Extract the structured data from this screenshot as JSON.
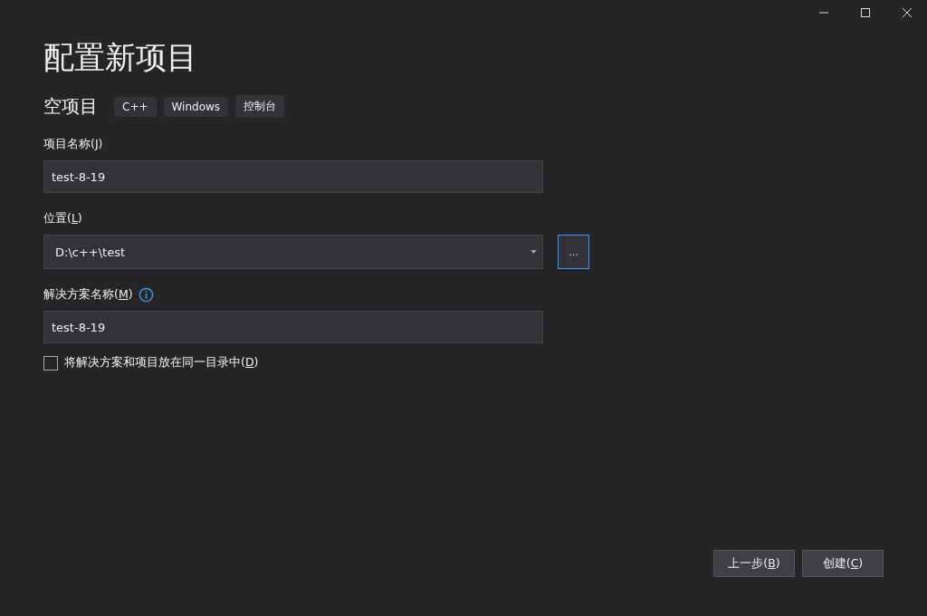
{
  "window": {
    "title": "配置新项目"
  },
  "template": {
    "name": "空项目",
    "tags": [
      "C++",
      "Windows",
      "控制台"
    ]
  },
  "fields": [
    {
      "kind": "text",
      "label": {
        "pre": "项目名称(",
        "key": "J",
        "post": ")"
      },
      "value": "test-8-19",
      "info": false
    },
    {
      "kind": "combo",
      "label": {
        "pre": "位置(",
        "key": "L",
        "post": ")"
      },
      "value": "D:\\c++\\test",
      "info": false,
      "browse": "...",
      "browse_focused": true
    },
    {
      "kind": "text",
      "label": {
        "pre": "解决方案名称(",
        "key": "M",
        "post": ")"
      },
      "value": "test-8-19",
      "info": true
    }
  ],
  "checkbox": {
    "label": {
      "pre": "将解决方案和项目放在同一目录中(",
      "key": "D",
      "post": ")"
    },
    "checked": false
  },
  "buttons": [
    {
      "pre": "上一步(",
      "key": "B",
      "post": ")"
    },
    {
      "pre": "创建(",
      "key": "C",
      "post": ")"
    }
  ]
}
